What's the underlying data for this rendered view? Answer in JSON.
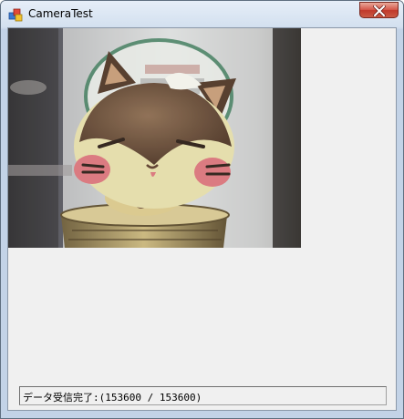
{
  "window": {
    "title": "CameraTest",
    "app_icon": "app-icon",
    "close_icon": "close-icon"
  },
  "camera": {
    "content": "live camera feed"
  },
  "status": {
    "text": "データ受信完了:(153600 / 153600)"
  },
  "colors": {
    "client_bg": "#f0f0f0",
    "close_button": "#c1392b",
    "titlebar": "#d3e0ef"
  }
}
